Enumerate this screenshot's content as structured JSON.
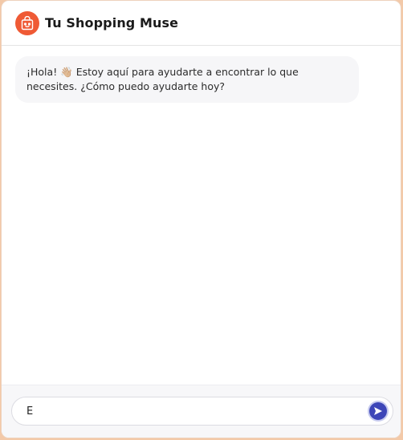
{
  "header": {
    "title": "Tu Shopping Muse",
    "logo_icon": "shopping-bag-icon",
    "brand_color": "#ef5a35"
  },
  "messages": [
    {
      "role": "bot",
      "text": "¡Hola! 👋🏼 Estoy aquí para ayudarte a encontrar lo que necesites. ¿Cómo puedo ayudarte hoy?"
    }
  ],
  "composer": {
    "input_value": "E",
    "send_icon": "send-arrow-icon",
    "send_color": "#3d46b8"
  }
}
